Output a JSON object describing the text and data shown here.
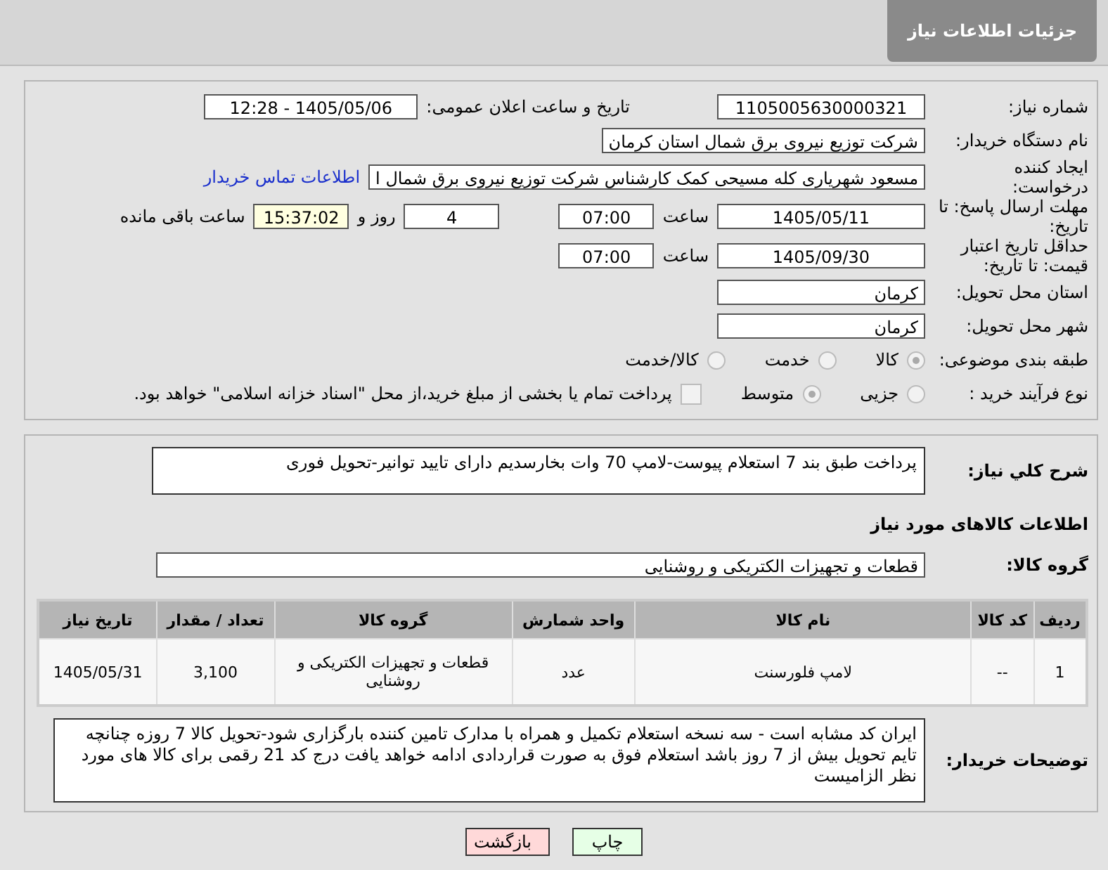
{
  "header": {
    "title": "جزئیات اطلاعات نیاز"
  },
  "details": {
    "need_number": {
      "label": "شماره نیاز:",
      "value": "1105005630000321"
    },
    "announce": {
      "label": "تاریخ و ساعت اعلان عمومی:",
      "value": "1405/05/06 - 12:28"
    },
    "buyer_org": {
      "label": "نام دستگاه خریدار:",
      "value": "شرکت توزیع نیروی برق شمال استان کرمان"
    },
    "requester": {
      "label": "ایجاد کننده درخواست:",
      "value": "مسعود شهریاری کله مسیحی کمک کارشناس شرکت توزیع نیروی برق شمال ا",
      "link": "اطلاعات تماس خریدار"
    },
    "reply_deadline": {
      "label": "مهلت ارسال پاسخ: تا تاریخ:",
      "date": "1405/05/11",
      "time_label": "ساعت",
      "time": "07:00",
      "days": "4",
      "days_label": "روز و",
      "remaining": "15:37:02",
      "remaining_label": "ساعت باقی مانده"
    },
    "price_validity": {
      "label": "حداقل تاریخ اعتبار قیمت: تا تاریخ:",
      "date": "1405/09/30",
      "time_label": "ساعت",
      "time": "07:00"
    },
    "province": {
      "label": "استان محل تحویل:",
      "value": "کرمان"
    },
    "city": {
      "label": "شهر محل تحویل:",
      "value": "کرمان"
    },
    "category": {
      "label": "طبقه بندی موضوعی:",
      "options": [
        {
          "label": "کالا",
          "selected": true
        },
        {
          "label": "خدمت",
          "selected": false
        },
        {
          "label": "کالا/خدمت",
          "selected": false
        }
      ]
    },
    "process": {
      "label": "نوع فرآیند خرید :",
      "options": [
        {
          "label": "جزیی",
          "selected": false
        },
        {
          "label": "متوسط",
          "selected": true
        }
      ],
      "payment": {
        "checked": false,
        "text": "پرداخت تمام یا بخشی از مبلغ خرید،از محل \"اسناد خزانه اسلامی\" خواهد بود."
      }
    }
  },
  "summary": {
    "label": "شرح کلي نیاز:",
    "value": "پرداخت طبق بند 7 استعلام پیوست-لامپ 70 وات بخارسدیم دارای تایید توانیر-تحویل فوری"
  },
  "goods": {
    "heading": "اطلاعات کالاهای مورد نیاز",
    "group_label": "گروه کالا:",
    "group_value": "قطعات و تجهیزات الکتریکی و روشنایی",
    "table": {
      "columns": [
        "ردیف",
        "کد کالا",
        "نام کالا",
        "واحد شمارش",
        "گروه کالا",
        "تعداد / مقدار",
        "تاریخ نیاز"
      ],
      "rows": [
        [
          "1",
          "--",
          "لامپ فلورسنت",
          "عدد",
          "قطعات و تجهیزات الکتریکی و روشنایی",
          "3,100",
          "1405/05/31"
        ]
      ]
    }
  },
  "notes": {
    "label": "توضیحات خریدار:",
    "value": "ایران کد مشابه است - سه نسخه استعلام تکمیل و همراه با مدارک تامین کننده بارگزاری شود-تحویل کالا 7 روزه چنانچه تایم تحویل بیش از 7 روز باشد استعلام فوق به صورت قراردادی ادامه خواهد یافت  درج کد 21 رقمی برای کالا های مورد نظر الزامیست"
  },
  "buttons": [
    {
      "kind": "print",
      "label": "چاپ"
    },
    {
      "kind": "back",
      "label": "بازگشت"
    }
  ]
}
